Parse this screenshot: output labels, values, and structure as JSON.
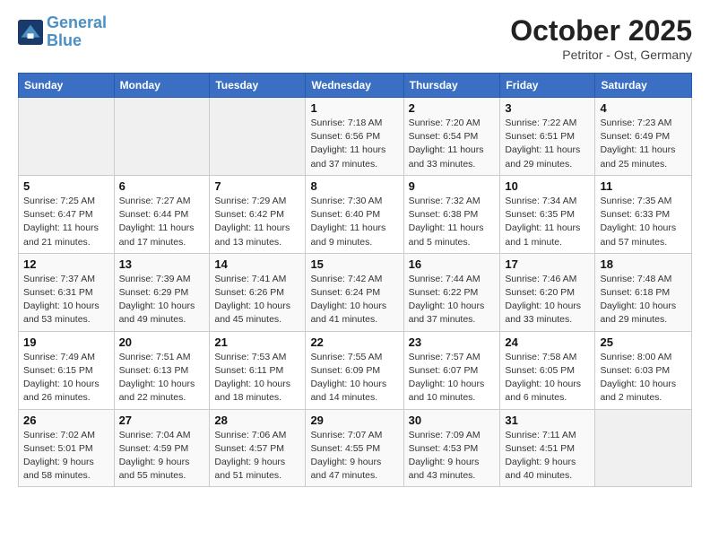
{
  "header": {
    "logo_line1": "General",
    "logo_line2": "Blue",
    "month": "October 2025",
    "location": "Petritor - Ost, Germany"
  },
  "weekdays": [
    "Sunday",
    "Monday",
    "Tuesday",
    "Wednesday",
    "Thursday",
    "Friday",
    "Saturday"
  ],
  "weeks": [
    [
      {
        "day": "",
        "info": ""
      },
      {
        "day": "",
        "info": ""
      },
      {
        "day": "",
        "info": ""
      },
      {
        "day": "1",
        "info": "Sunrise: 7:18 AM\nSunset: 6:56 PM\nDaylight: 11 hours and 37 minutes."
      },
      {
        "day": "2",
        "info": "Sunrise: 7:20 AM\nSunset: 6:54 PM\nDaylight: 11 hours and 33 minutes."
      },
      {
        "day": "3",
        "info": "Sunrise: 7:22 AM\nSunset: 6:51 PM\nDaylight: 11 hours and 29 minutes."
      },
      {
        "day": "4",
        "info": "Sunrise: 7:23 AM\nSunset: 6:49 PM\nDaylight: 11 hours and 25 minutes."
      }
    ],
    [
      {
        "day": "5",
        "info": "Sunrise: 7:25 AM\nSunset: 6:47 PM\nDaylight: 11 hours and 21 minutes."
      },
      {
        "day": "6",
        "info": "Sunrise: 7:27 AM\nSunset: 6:44 PM\nDaylight: 11 hours and 17 minutes."
      },
      {
        "day": "7",
        "info": "Sunrise: 7:29 AM\nSunset: 6:42 PM\nDaylight: 11 hours and 13 minutes."
      },
      {
        "day": "8",
        "info": "Sunrise: 7:30 AM\nSunset: 6:40 PM\nDaylight: 11 hours and 9 minutes."
      },
      {
        "day": "9",
        "info": "Sunrise: 7:32 AM\nSunset: 6:38 PM\nDaylight: 11 hours and 5 minutes."
      },
      {
        "day": "10",
        "info": "Sunrise: 7:34 AM\nSunset: 6:35 PM\nDaylight: 11 hours and 1 minute."
      },
      {
        "day": "11",
        "info": "Sunrise: 7:35 AM\nSunset: 6:33 PM\nDaylight: 10 hours and 57 minutes."
      }
    ],
    [
      {
        "day": "12",
        "info": "Sunrise: 7:37 AM\nSunset: 6:31 PM\nDaylight: 10 hours and 53 minutes."
      },
      {
        "day": "13",
        "info": "Sunrise: 7:39 AM\nSunset: 6:29 PM\nDaylight: 10 hours and 49 minutes."
      },
      {
        "day": "14",
        "info": "Sunrise: 7:41 AM\nSunset: 6:26 PM\nDaylight: 10 hours and 45 minutes."
      },
      {
        "day": "15",
        "info": "Sunrise: 7:42 AM\nSunset: 6:24 PM\nDaylight: 10 hours and 41 minutes."
      },
      {
        "day": "16",
        "info": "Sunrise: 7:44 AM\nSunset: 6:22 PM\nDaylight: 10 hours and 37 minutes."
      },
      {
        "day": "17",
        "info": "Sunrise: 7:46 AM\nSunset: 6:20 PM\nDaylight: 10 hours and 33 minutes."
      },
      {
        "day": "18",
        "info": "Sunrise: 7:48 AM\nSunset: 6:18 PM\nDaylight: 10 hours and 29 minutes."
      }
    ],
    [
      {
        "day": "19",
        "info": "Sunrise: 7:49 AM\nSunset: 6:15 PM\nDaylight: 10 hours and 26 minutes."
      },
      {
        "day": "20",
        "info": "Sunrise: 7:51 AM\nSunset: 6:13 PM\nDaylight: 10 hours and 22 minutes."
      },
      {
        "day": "21",
        "info": "Sunrise: 7:53 AM\nSunset: 6:11 PM\nDaylight: 10 hours and 18 minutes."
      },
      {
        "day": "22",
        "info": "Sunrise: 7:55 AM\nSunset: 6:09 PM\nDaylight: 10 hours and 14 minutes."
      },
      {
        "day": "23",
        "info": "Sunrise: 7:57 AM\nSunset: 6:07 PM\nDaylight: 10 hours and 10 minutes."
      },
      {
        "day": "24",
        "info": "Sunrise: 7:58 AM\nSunset: 6:05 PM\nDaylight: 10 hours and 6 minutes."
      },
      {
        "day": "25",
        "info": "Sunrise: 8:00 AM\nSunset: 6:03 PM\nDaylight: 10 hours and 2 minutes."
      }
    ],
    [
      {
        "day": "26",
        "info": "Sunrise: 7:02 AM\nSunset: 5:01 PM\nDaylight: 9 hours and 58 minutes."
      },
      {
        "day": "27",
        "info": "Sunrise: 7:04 AM\nSunset: 4:59 PM\nDaylight: 9 hours and 55 minutes."
      },
      {
        "day": "28",
        "info": "Sunrise: 7:06 AM\nSunset: 4:57 PM\nDaylight: 9 hours and 51 minutes."
      },
      {
        "day": "29",
        "info": "Sunrise: 7:07 AM\nSunset: 4:55 PM\nDaylight: 9 hours and 47 minutes."
      },
      {
        "day": "30",
        "info": "Sunrise: 7:09 AM\nSunset: 4:53 PM\nDaylight: 9 hours and 43 minutes."
      },
      {
        "day": "31",
        "info": "Sunrise: 7:11 AM\nSunset: 4:51 PM\nDaylight: 9 hours and 40 minutes."
      },
      {
        "day": "",
        "info": ""
      }
    ]
  ]
}
